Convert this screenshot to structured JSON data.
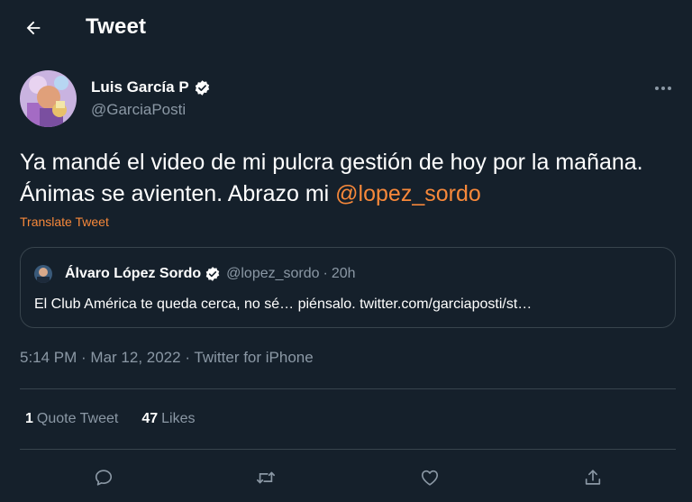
{
  "header": {
    "title": "Tweet"
  },
  "author": {
    "name": "Luis García P",
    "handle": "@GarciaPosti"
  },
  "tweet": {
    "text": "Ya mandé el video de mi pulcra gestión de hoy por la mañana. Ánimas se avienten. Abrazo mi ",
    "mention": "@lopez_sordo",
    "translate_label": "Translate Tweet"
  },
  "quote": {
    "name": "Álvaro López Sordo",
    "handle": "@lopez_sordo",
    "separator": "·",
    "time": "20h",
    "text": "El Club América te queda cerca, no sé… piénsalo. twitter.com/garciaposti/st…"
  },
  "meta": {
    "time": "5:14 PM",
    "separator": " · ",
    "date": "Mar 12, 2022",
    "source": "Twitter for iPhone"
  },
  "stats": {
    "quote_count": "1",
    "quote_label": "Quote Tweet",
    "likes_count": "47",
    "likes_label": "Likes"
  },
  "icons": {
    "back": "arrow-left-icon",
    "verified": "verified-badge-icon",
    "more": "more-horizontal-icon",
    "reply": "reply-icon",
    "retweet": "retweet-icon",
    "like": "heart-icon",
    "share": "share-icon"
  },
  "colors": {
    "background": "#15202b",
    "accent": "#f7883a",
    "secondary_text": "#8b98a5",
    "border": "#38444d"
  }
}
